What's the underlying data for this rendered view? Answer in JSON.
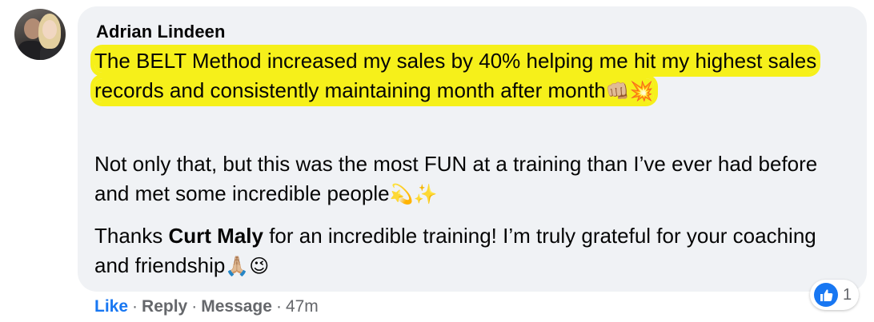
{
  "comment": {
    "author": "Adrian Lindeen",
    "paragraph1": {
      "text": "The BELT Method increased my sales by 40% helping me hit my highest sales records and consistently maintaining month after month",
      "emojis": "👊🏼💥"
    },
    "paragraph2": {
      "text": "Not only that, but this was the most FUN at a training than I’ve ever had before and met some incredible people",
      "emojis": "💫✨"
    },
    "paragraph3": {
      "before": "Thanks ",
      "mention": "Curt Maly",
      "after": " for an incredible training! I’m truly grateful for your coaching and friendship",
      "emojis": "🙏🏼😉"
    }
  },
  "actions": {
    "like": "Like",
    "reply": "Reply",
    "message": "Message",
    "separator": "·",
    "time": "47m"
  },
  "reactions": {
    "icon": "like-thumbs-up-icon",
    "count": "1",
    "color": "#1877f2"
  },
  "colors": {
    "bubble": "#f0f2f5",
    "highlight": "#f6f01a",
    "link_blue": "#1877f2",
    "secondary_text": "#65676b"
  }
}
